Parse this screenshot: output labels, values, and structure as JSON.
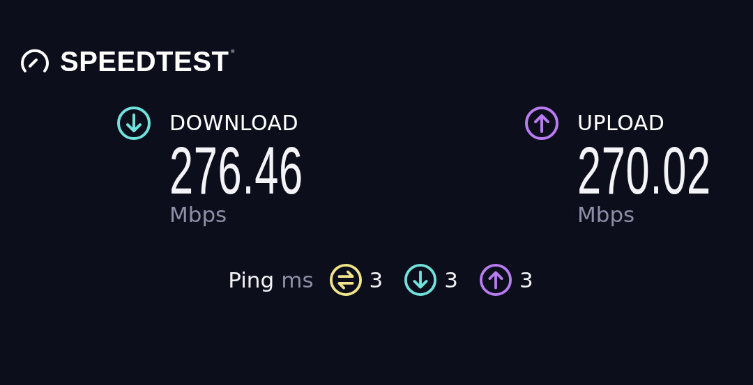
{
  "logo": {
    "text": "SPEEDTEST",
    "mark": "®"
  },
  "metrics": [
    {
      "kind": "download",
      "color": "#6fe3dc",
      "label": "DOWNLOAD",
      "value": "276.46",
      "unit": "Mbps"
    },
    {
      "kind": "upload",
      "color": "#b87cf0",
      "label": "UPLOAD",
      "value": "270.02",
      "unit": "Mbps"
    }
  ],
  "ping": {
    "label": "Ping",
    "unit": "ms",
    "items": [
      {
        "kind": "idle",
        "color": "#f2e48a",
        "value": "3"
      },
      {
        "kind": "download",
        "color": "#6fe3dc",
        "value": "3"
      },
      {
        "kind": "upload",
        "color": "#b87cf0",
        "value": "3"
      }
    ]
  }
}
